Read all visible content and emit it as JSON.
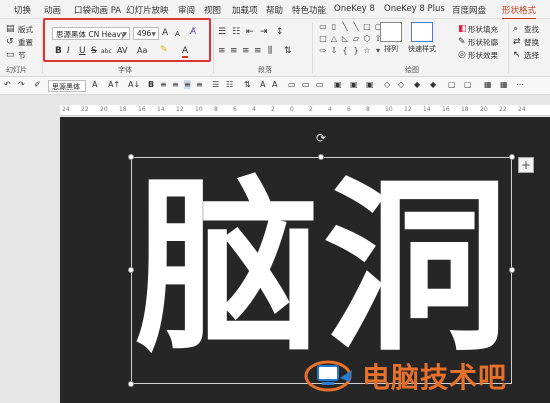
{
  "ribbon_tabs": [
    {
      "label": "切换"
    },
    {
      "label": "动画"
    },
    {
      "label": "口袋动画 PA"
    },
    {
      "label": "幻灯片放映"
    },
    {
      "label": "审阅"
    },
    {
      "label": "视图"
    },
    {
      "label": "帮助"
    },
    {
      "label": "特色功能"
    },
    {
      "label": "OneKey 8"
    },
    {
      "label": "OneKey 8 Plus"
    },
    {
      "label": "百度网盘"
    },
    {
      "label": "形状格式"
    }
  ],
  "active_tab": "形状格式",
  "slides_group": {
    "layout_label": "版式",
    "reset_label": "重置",
    "section_label": "节",
    "group_label": "幻灯片"
  },
  "font_group": {
    "font_name": "思源黑体 CN Heavy",
    "font_size": "496",
    "group_label": "字体",
    "bold": "B",
    "italic": "I",
    "underline": "U",
    "strike": "S",
    "shadow": "abc",
    "spacing": "AV",
    "case": "Aa",
    "font_color": "A",
    "grow": "A",
    "shrink": "A"
  },
  "paragraph_group": {
    "group_label": "段落"
  },
  "drawing_group": {
    "group_label": "绘图",
    "arrange_label": "排列",
    "quick_styles_label": "快速样式",
    "fill_label": "形状填充",
    "outline_label": "形状轮廓",
    "effects_label": "形状效果"
  },
  "editing_group": {
    "find_label": "查找",
    "replace_label": "替换",
    "select_label": "选择"
  },
  "minibar": {
    "font_name": "思源黑体",
    "font_size": "A"
  },
  "ruler_ticks": [
    "24",
    "22",
    "20",
    "18",
    "16",
    "14",
    "12",
    "10",
    "8",
    "6",
    "4",
    "2",
    "0",
    "2",
    "4",
    "6",
    "8",
    "10",
    "12",
    "14",
    "16",
    "18",
    "20",
    "22",
    "24"
  ],
  "slide": {
    "text": "脑洞",
    "background": "#262626",
    "text_color": "#ffffff"
  },
  "watermark": {
    "text": "电脑技术吧",
    "color": "#e7702a"
  },
  "colors": {
    "accent_tab": "#c43e1c",
    "highlight_box": "#e03434"
  }
}
